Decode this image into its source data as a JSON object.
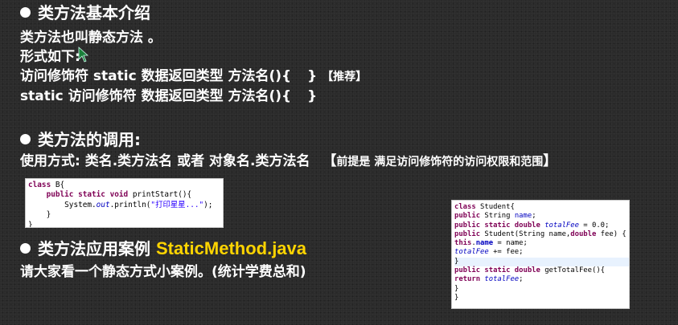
{
  "section1": {
    "title": "类方法基本介绍",
    "line1": "类方法也叫静态方法 。",
    "line2": "形式如下:",
    "line3a": "访问修饰符 static 数据返回类型 方法名(){",
    "line3b": "}",
    "line3tag": "【推荐】",
    "line4a": "static 访问修饰符 数据返回类型 方法名(){",
    "line4b": "}"
  },
  "section2": {
    "title": "类方法的调用:",
    "usage": "使用方式: 类名.类方法名 或者 对象名.类方法名",
    "note_open": "【",
    "note": "前提是 满足访问修饰符的访问权限和范围",
    "note_close": "】"
  },
  "section3": {
    "title": "类方法应用案例",
    "filename": "StaticMethod.java",
    "desc": "请大家看一个静态方式小案例。(统计学费总和)"
  },
  "code_b": {
    "l1_kw": "class",
    "l1_rest": " B{",
    "l2_kw": "public static void",
    "l2_rest": " printStart(){",
    "l3_a": "System.",
    "l3_out": "out",
    "l3_b": ".println(",
    "l3_str": "\"打印星星...\"",
    "l3_c": ");",
    "l4": "}",
    "l5": "}"
  },
  "code_student": {
    "r1_kw": "class",
    "r1_rest": " Student{",
    "r2_kw": "public",
    "r2_rest": " String ",
    "r2_f": "name",
    "r2_end": ";",
    "r3_kw": "public static double",
    "r3_f": "totalFee",
    "r3_end": " = 0.0;",
    "r4_kw": "public",
    "r4_rest": " Student(String name,",
    "r4_kw2": "double",
    "r4_end": " fee) {",
    "r5_kw": "this",
    "r5_dot": ".",
    "r5_f": "name",
    "r5_end": " = name;",
    "r6_f": "totalFee",
    "r6_end": " += fee;",
    "r7": "}",
    "r8_kw": "public static double",
    "r8_rest": " getTotalFee(){",
    "r9_kw": "return",
    "r9_f": "totalFee",
    "r9_end": ";",
    "r10": "}",
    "r11": "}"
  }
}
